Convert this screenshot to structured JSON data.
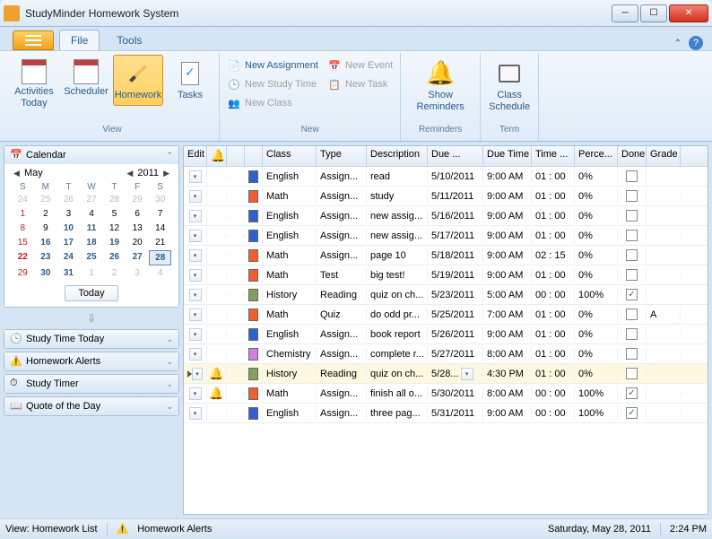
{
  "title": "StudyMinder Homework System",
  "tabs": {
    "file": "File",
    "tools": "Tools"
  },
  "ribbon": {
    "view": {
      "label": "View",
      "activities": "Activities Today",
      "scheduler": "Scheduler",
      "homework": "Homework",
      "tasks": "Tasks"
    },
    "new": {
      "label": "New",
      "assignment": "New Assignment",
      "studytime": "New Study Time",
      "class": "New Class",
      "event": "New Event",
      "task": "New Task"
    },
    "reminders": {
      "label": "Reminders",
      "show": "Show Reminders"
    },
    "term": {
      "label": "Term",
      "schedule": "Class Schedule"
    }
  },
  "sidebar": {
    "calendar": "Calendar",
    "month": "May",
    "year": "2011",
    "dow": [
      "S",
      "M",
      "T",
      "W",
      "T",
      "F",
      "S"
    ],
    "today_btn": "Today",
    "study_time": "Study Time Today",
    "alerts": "Homework Alerts",
    "timer": "Study Timer",
    "quote": "Quote of the Day"
  },
  "columns": {
    "edit": "Edit",
    "bell": "",
    "class": "Class",
    "type": "Type",
    "desc": "Description",
    "due": "Due ...",
    "time": "Due Time",
    "est": "Time ...",
    "pct": "Perce...",
    "done": "Done",
    "grade": "Grade"
  },
  "rows": [
    {
      "color": "#3060d0",
      "class": "English",
      "type": "Assign...",
      "desc": "read",
      "due": "5/10/2011",
      "time": "9:00 AM",
      "est": "01 : 00",
      "pct": "0%",
      "done": false,
      "grade": "",
      "bell": false
    },
    {
      "color": "#f06030",
      "class": "Math",
      "type": "Assign...",
      "desc": "study",
      "due": "5/11/2011",
      "time": "9:00 AM",
      "est": "01 : 00",
      "pct": "0%",
      "done": false,
      "grade": "",
      "bell": false
    },
    {
      "color": "#3060d0",
      "class": "English",
      "type": "Assign...",
      "desc": "new assig...",
      "due": "5/16/2011",
      "time": "9:00 AM",
      "est": "01 : 00",
      "pct": "0%",
      "done": false,
      "grade": "",
      "bell": false
    },
    {
      "color": "#3060d0",
      "class": "English",
      "type": "Assign...",
      "desc": "new assig...",
      "due": "5/17/2011",
      "time": "9:00 AM",
      "est": "01 : 00",
      "pct": "0%",
      "done": false,
      "grade": "",
      "bell": false
    },
    {
      "color": "#f06030",
      "class": "Math",
      "type": "Assign...",
      "desc": "page 10",
      "due": "5/18/2011",
      "time": "9:00 AM",
      "est": "02 : 15",
      "pct": "0%",
      "done": false,
      "grade": "",
      "bell": false
    },
    {
      "color": "#f06030",
      "class": "Math",
      "type": "Test",
      "desc": "big test!",
      "due": "5/19/2011",
      "time": "9:00 AM",
      "est": "01 : 00",
      "pct": "0%",
      "done": false,
      "grade": "",
      "bell": false
    },
    {
      "color": "#80a060",
      "class": "History",
      "type": "Reading",
      "desc": "quiz on ch...",
      "due": "5/23/2011",
      "time": "5:00 AM",
      "est": "00 : 00",
      "pct": "100%",
      "done": true,
      "grade": "",
      "bell": false
    },
    {
      "color": "#f06030",
      "class": "Math",
      "type": "Quiz",
      "desc": "do odd pr...",
      "due": "5/25/2011",
      "time": "7:00 AM",
      "est": "01 : 00",
      "pct": "0%",
      "done": false,
      "grade": "A",
      "bell": false
    },
    {
      "color": "#3060d0",
      "class": "English",
      "type": "Assign...",
      "desc": "book report",
      "due": "5/26/2011",
      "time": "9:00 AM",
      "est": "01 : 00",
      "pct": "0%",
      "done": false,
      "grade": "",
      "bell": false
    },
    {
      "color": "#d080e0",
      "class": "Chemistry",
      "type": "Assign...",
      "desc": "complete r...",
      "due": "5/27/2011",
      "time": "8:00 AM",
      "est": "01 : 00",
      "pct": "0%",
      "done": false,
      "grade": "",
      "bell": false
    },
    {
      "color": "#80a060",
      "class": "History",
      "type": "Reading",
      "desc": "quiz on ch...",
      "due": "5/28...",
      "time": "4:30 PM",
      "est": "01 : 00",
      "pct": "0%",
      "done": false,
      "grade": "",
      "bell": true,
      "hl": true,
      "dueDrop": true,
      "selector": true
    },
    {
      "color": "#f06030",
      "class": "Math",
      "type": "Assign...",
      "desc": "finish all o...",
      "due": "5/30/2011",
      "time": "8:00 AM",
      "est": "00 : 00",
      "pct": "100%",
      "done": true,
      "grade": "",
      "bell": true
    },
    {
      "color": "#3060d0",
      "class": "English",
      "type": "Assign...",
      "desc": "three pag...",
      "due": "5/31/2011",
      "time": "9:00 AM",
      "est": "00 : 00",
      "pct": "100%",
      "done": true,
      "grade": "",
      "bell": false
    }
  ],
  "status": {
    "view": "View: Homework List",
    "alerts": "Homework Alerts",
    "date": "Saturday, May 28, 2011",
    "time": "2:24 PM"
  }
}
